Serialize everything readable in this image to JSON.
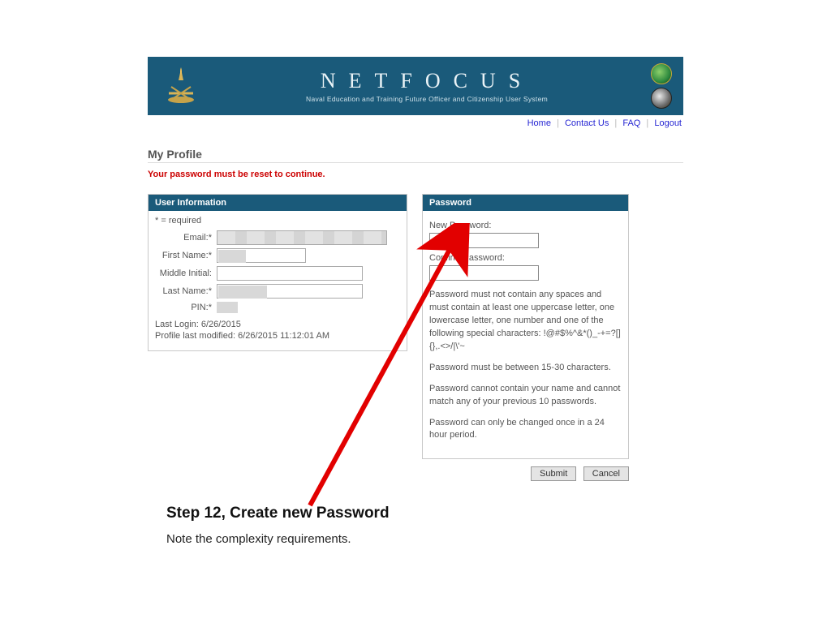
{
  "banner": {
    "title": "NETFOCUS",
    "subtitle": "Naval Education and Training Future Officer and Citizenship User System"
  },
  "topnav": {
    "home": "Home",
    "contact": "Contact Us",
    "faq": "FAQ",
    "logout": "Logout"
  },
  "profile": {
    "heading": "My Profile",
    "warning": "Your password must be reset to continue."
  },
  "userinfo": {
    "header": "User Information",
    "required_note": "* = required",
    "labels": {
      "email": "Email:*",
      "first": "First Name:*",
      "mi": "Middle Initial:",
      "last": "Last Name:*",
      "pin": "PIN:*"
    },
    "last_login": "Last Login: 6/26/2015",
    "last_modified": "Profile last modified: 6/26/2015 11:12:01 AM"
  },
  "password": {
    "header": "Password",
    "new_label": "New Password:",
    "confirm_label": "Confirm Password:",
    "rule1": "Password must not contain any spaces and must contain at least one uppercase letter, one lowercase letter, one number and one of the following special characters: !@#$%^&*()_-+=?[]{},.<>/|\\'~",
    "rule2": "Password must be between 15-30 characters.",
    "rule3": "Password cannot contain your name and cannot match any of your previous 10 passwords.",
    "rule4": "Password can only be changed once in a 24 hour period.",
    "submit": "Submit",
    "cancel": "Cancel"
  },
  "caption": {
    "title": "Step 12, Create new Password",
    "note": "Note the complexity requirements."
  }
}
